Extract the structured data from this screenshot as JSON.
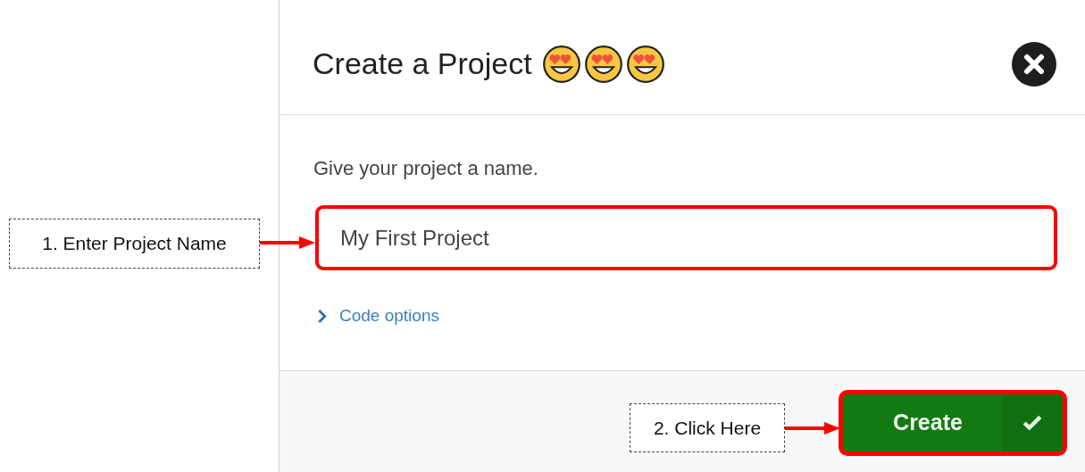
{
  "dialog": {
    "title": "Create a Project",
    "prompt": "Give your project a name.",
    "name_field": {
      "value": "My First Project",
      "highlighted": true
    },
    "code_options": {
      "label": "Code options",
      "expanded": false
    },
    "create_button": {
      "label": "Create",
      "highlighted": true
    }
  },
  "annotations": [
    {
      "text": "1. Enter Project Name"
    },
    {
      "text": "2. Click Here"
    }
  ]
}
